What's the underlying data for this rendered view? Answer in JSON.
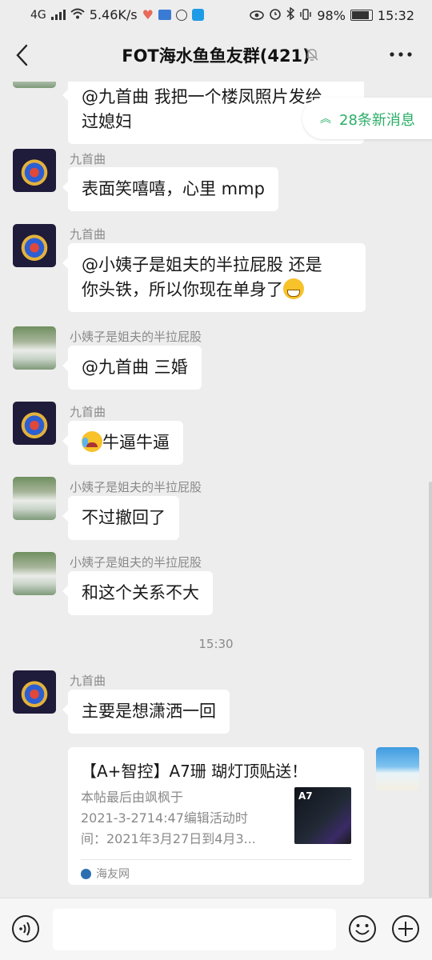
{
  "status_bar": {
    "network_label": "4G",
    "speed": "5.46K/s",
    "battery": "98%",
    "time": "15:32"
  },
  "header": {
    "title": "FOT海水鱼鱼友群(421)"
  },
  "new_messages": {
    "label": "28条新消息"
  },
  "messages": [
    {
      "sender": "",
      "text": "@九首曲  我把一个楼凤照片发给\n过媳妇"
    },
    {
      "sender": "九首曲",
      "text": "表面笑嘻嘻，心里 mmp"
    },
    {
      "sender": "九首曲",
      "text_line1": "@小姨子是姐夫的半拉屁股  还是",
      "text_line2": "你头铁，所以你现在单身了"
    },
    {
      "sender": "小姨子是姐夫的半拉屁股",
      "text": "@九首曲  三婚"
    },
    {
      "sender": "九首曲",
      "text": "牛逼牛逼"
    },
    {
      "sender": "小姨子是姐夫的半拉屁股",
      "text": "不过撤回了"
    },
    {
      "sender": "小姨子是姐夫的半拉屁股",
      "text": "和这个关系不大"
    },
    {
      "sender": "九首曲",
      "text": "主要是想潇洒一回"
    }
  ],
  "timestamp": "15:30",
  "link_card": {
    "title": "【A+智控】A7珊 瑚灯顶贴送！",
    "desc_line1": "本帖最后由飒枫于",
    "desc_line2": "2021-3-2714:47编辑活动时",
    "desc_line3": "间：2021年3月27日到4月3...",
    "thumb_label": "A7",
    "source": "海友网"
  },
  "icons": {
    "back": "chevron-left-icon",
    "mute": "bell-off-icon",
    "more": "more-dots-icon",
    "voice": "voice-icon",
    "emoji": "emoji-icon",
    "plus": "plus-icon"
  },
  "colors": {
    "background": "#ededed",
    "bubble": "#ffffff",
    "accent_green": "#2aae67",
    "meta_gray": "#8a8a8a"
  }
}
